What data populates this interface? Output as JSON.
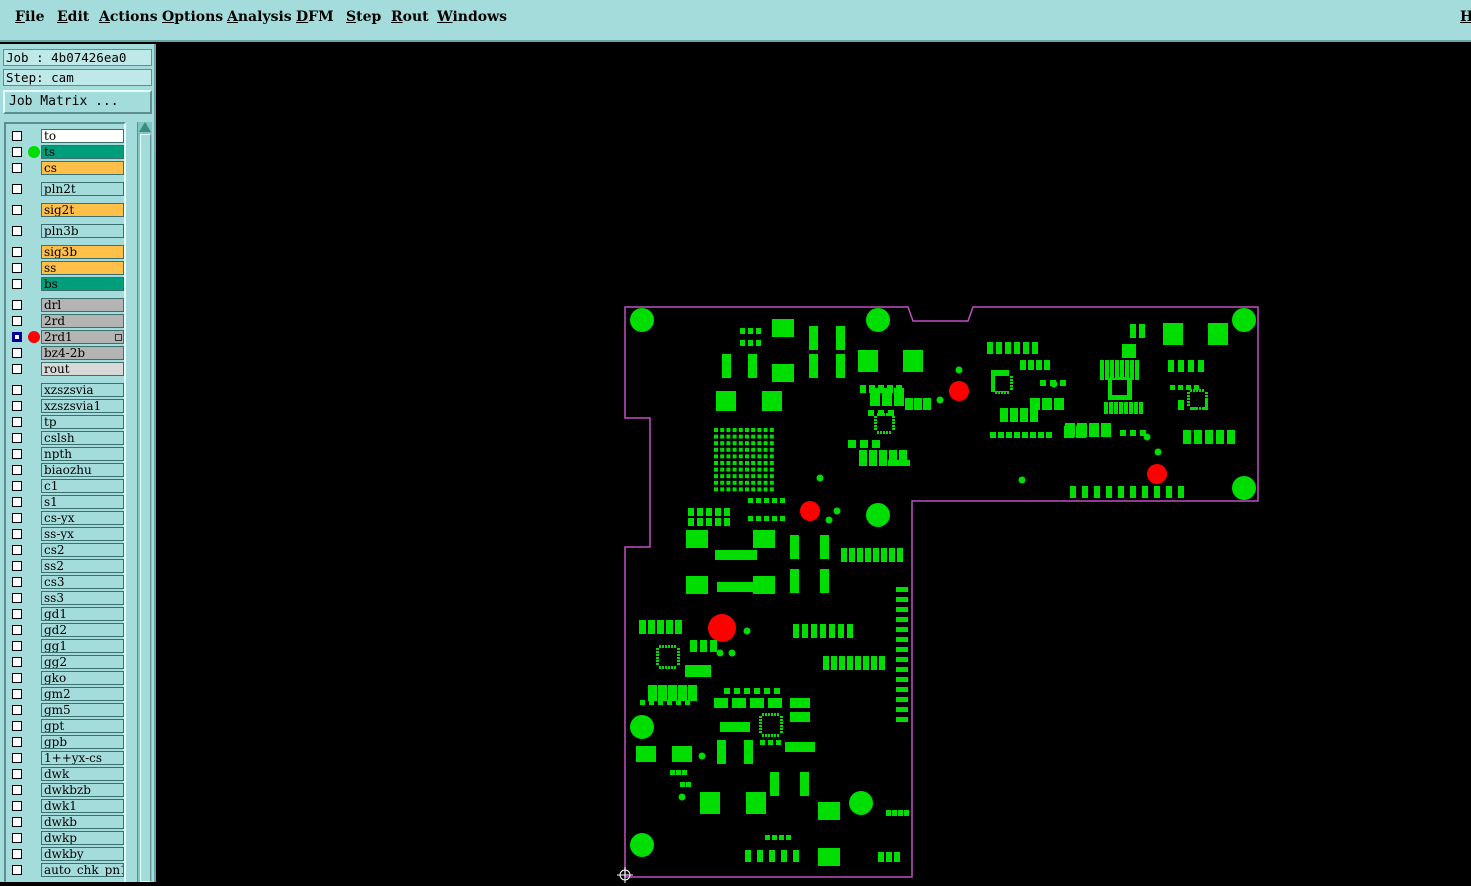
{
  "menubar": {
    "items": [
      "File",
      "Edit",
      "Actions",
      "Options",
      "Analysis",
      "DFM",
      "Step",
      "Rout",
      "Windows"
    ],
    "help_label": "H"
  },
  "job": {
    "job_label": "Job : 4b07426ea0",
    "step_label": "Step: cam",
    "matrix_button": "Job Matrix ..."
  },
  "layers": [
    {
      "name": "to",
      "color": "#ffffff"
    },
    {
      "name": "ts",
      "color": "#009e7a",
      "dot": "#00dd00"
    },
    {
      "name": "cs",
      "color": "#ffc04a"
    },
    {
      "name": "pln2t",
      "color": "#a4dcdc"
    },
    {
      "name": "sig2t",
      "color": "#ffc04a"
    },
    {
      "name": "pln3b",
      "color": "#a4dcdc"
    },
    {
      "name": "sig3b",
      "color": "#ffc04a"
    },
    {
      "name": "ss",
      "color": "#ffc04a"
    },
    {
      "name": "bs",
      "color": "#009e7a"
    },
    {
      "name": "drl",
      "color": "#b4b4b4"
    },
    {
      "name": "2rd",
      "color": "#b4b4b4"
    },
    {
      "name": "2rd1",
      "color": "#b4b4b4",
      "dot": "#ff0000",
      "active": true
    },
    {
      "name": "bz4-2b",
      "color": "#b4b4b4"
    },
    {
      "name": "rout",
      "color": "#d8d8d8"
    },
    {
      "name": "xzszsvia",
      "color": "#a4dcdc"
    },
    {
      "name": "xzszsvia1",
      "color": "#a4dcdc"
    },
    {
      "name": "tp",
      "color": "#a4dcdc"
    },
    {
      "name": "cslsh",
      "color": "#a4dcdc"
    },
    {
      "name": "npth",
      "color": "#a4dcdc"
    },
    {
      "name": "biaozhu",
      "color": "#a4dcdc"
    },
    {
      "name": "c1",
      "color": "#a4dcdc"
    },
    {
      "name": "s1",
      "color": "#a4dcdc"
    },
    {
      "name": "cs-yx",
      "color": "#a4dcdc"
    },
    {
      "name": "ss-yx",
      "color": "#a4dcdc"
    },
    {
      "name": "cs2",
      "color": "#a4dcdc"
    },
    {
      "name": "ss2",
      "color": "#a4dcdc"
    },
    {
      "name": "cs3",
      "color": "#a4dcdc"
    },
    {
      "name": "ss3",
      "color": "#a4dcdc"
    },
    {
      "name": "gd1",
      "color": "#a4dcdc"
    },
    {
      "name": "gd2",
      "color": "#a4dcdc"
    },
    {
      "name": "gg1",
      "color": "#a4dcdc"
    },
    {
      "name": "gg2",
      "color": "#a4dcdc"
    },
    {
      "name": "gko",
      "color": "#a4dcdc"
    },
    {
      "name": "gm2",
      "color": "#a4dcdc"
    },
    {
      "name": "gm5",
      "color": "#a4dcdc"
    },
    {
      "name": "gpt",
      "color": "#a4dcdc"
    },
    {
      "name": "gpb",
      "color": "#a4dcdc"
    },
    {
      "name": "1++yx-cs",
      "color": "#a4dcdc"
    },
    {
      "name": "dwk",
      "color": "#a4dcdc"
    },
    {
      "name": "dwkbzb",
      "color": "#a4dcdc"
    },
    {
      "name": "dwk1",
      "color": "#a4dcdc"
    },
    {
      "name": "dwkb",
      "color": "#a4dcdc"
    },
    {
      "name": "dwkp",
      "color": "#a4dcdc"
    },
    {
      "name": "dwkby",
      "color": "#a4dcdc"
    },
    {
      "name": "auto_chk_pn1",
      "color": "#a4dcdc"
    }
  ],
  "colors": {
    "pad": "#00dd00",
    "drill": "#ff0000",
    "outline": "#c050c0",
    "panel": "#a4dcdc"
  }
}
